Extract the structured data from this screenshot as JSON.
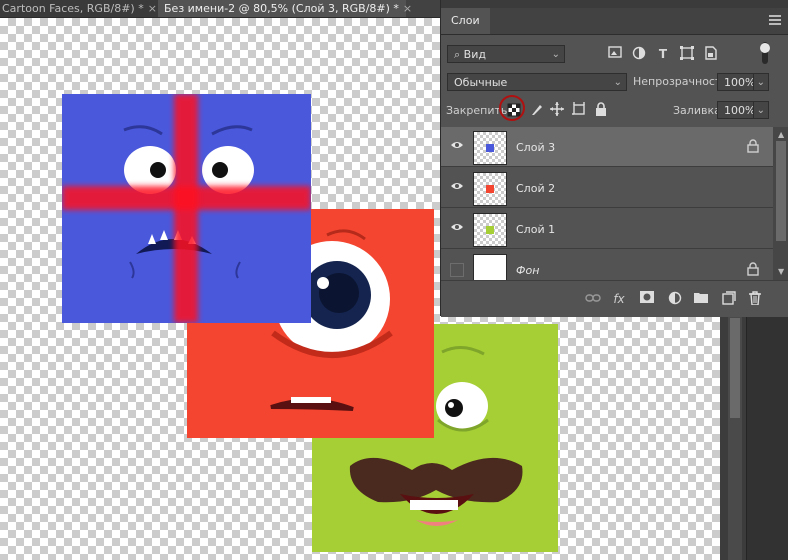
{
  "tabs": [
    {
      "label": "Cartoon Faces, RGB/8#) *",
      "close": "×"
    },
    {
      "label": "Без имени-2 @ 80,5% (Слой 3, RGB/8#) *",
      "close": "×"
    }
  ],
  "panel": {
    "title": "Слои",
    "filter": {
      "value": "Вид"
    },
    "blend_mode": {
      "value": "Обычные"
    },
    "opacity": {
      "label": "Непрозрачность:",
      "value": "100%"
    },
    "lock": {
      "label": "Закрепить:"
    },
    "fill": {
      "label": "Заливка:",
      "value": "100%"
    },
    "layers": [
      {
        "name": "Слой 3",
        "selected": true,
        "visible": true,
        "locked": true,
        "thumb_color": "#4a58dc"
      },
      {
        "name": "Слой 2",
        "selected": false,
        "visible": true,
        "locked": false,
        "thumb_color": "#f44530"
      },
      {
        "name": "Слой 1",
        "selected": false,
        "visible": true,
        "locked": false,
        "thumb_color": "#a6cf35"
      },
      {
        "name": "Фон",
        "selected": false,
        "visible": false,
        "locked": true,
        "thumb_color": "#ffffff"
      }
    ],
    "footer_icons": [
      "link-icon",
      "fx-icon",
      "mask-icon",
      "adjustment-icon",
      "folder-icon",
      "new-layer-icon",
      "trash-icon"
    ],
    "fx_label": "fx"
  },
  "colors": {
    "blue": "#4a58dc",
    "red": "#f44530",
    "green": "#a6cf35",
    "accent_circle": "#b01010"
  }
}
